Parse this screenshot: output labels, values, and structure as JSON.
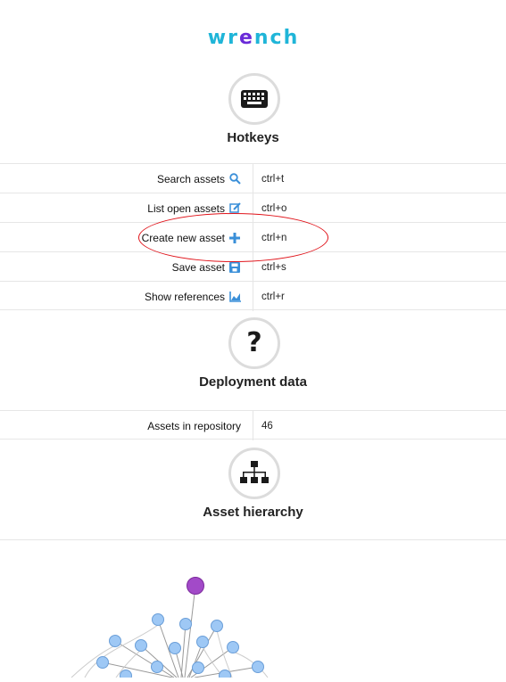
{
  "app": {
    "logo_text": "wrench"
  },
  "hotkeys": {
    "title": "Hotkeys",
    "icon": "keyboard-icon",
    "rows": [
      {
        "label": "Search assets",
        "icon": "search-icon",
        "key": "ctrl+t"
      },
      {
        "label": "List open assets",
        "icon": "edit-icon",
        "key": "ctrl+o"
      },
      {
        "label": "Create new asset",
        "icon": "plus-icon",
        "key": "ctrl+n"
      },
      {
        "label": "Save asset",
        "icon": "save-icon",
        "key": "ctrl+s"
      },
      {
        "label": "Show references",
        "icon": "chart-icon",
        "key": "ctrl+r"
      }
    ]
  },
  "deployment": {
    "title": "Deployment data",
    "icon": "question-icon",
    "rows": [
      {
        "label": "Assets in repository",
        "value": "46"
      }
    ]
  },
  "hierarchy": {
    "title": "Asset hierarchy",
    "icon": "sitemap-icon"
  },
  "colors": {
    "accent": "#3a8fd8",
    "logo_blue": "#1fb5d8",
    "logo_purple": "#6a2ad8",
    "root_node": "#a24ac8",
    "node": "#9ec8f5",
    "annotation": "#e0141b"
  }
}
